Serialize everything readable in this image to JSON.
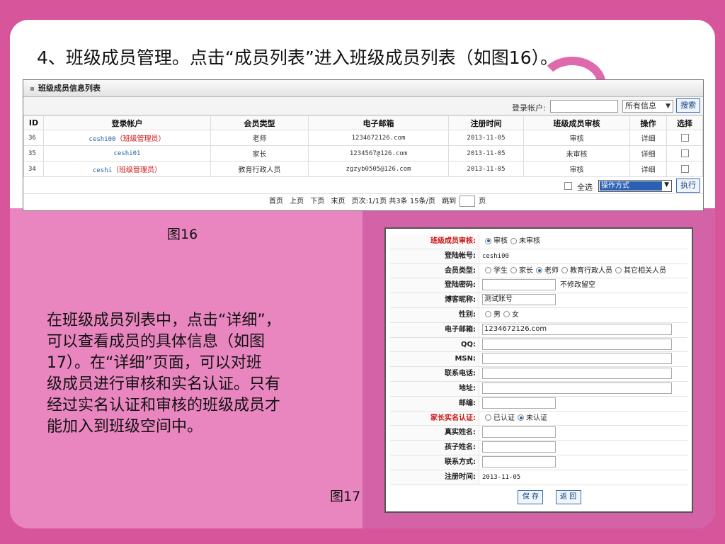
{
  "slide": {
    "heading": "4、班级成员管理。点击“成员列表”进入班级成员列表（如图16）。",
    "caption16": "图16",
    "caption17": "图17",
    "body_lines": [
      "在班级成员列表中，点击“详细”，",
      "可以查看成员的具体信息（如图",
      "17）。在“详细”页面，可以对班",
      "级成员进行审核和实名认证。只有",
      "经过实名认证和审核的班级成员才",
      "能加入到班级空间中。"
    ],
    "colors": {
      "pink_light": "#e986c0",
      "pink_dark": "#d462a6",
      "accent_red": "#d01010",
      "link_blue": "#1f5fa8"
    }
  },
  "fig16": {
    "title": "班级成员信息列表",
    "search": {
      "label": "登录帐户:",
      "value": "",
      "scope": "所有信息",
      "button": "搜索"
    },
    "columns": [
      "ID",
      "登录帐户",
      "会员类型",
      "电子邮箱",
      "注册时间",
      "班级成员审核",
      "操作",
      "选择"
    ],
    "rows": [
      {
        "id": "36",
        "account": "ceshi00",
        "role_tag": "（班级管理员）",
        "type": "老师",
        "email": "1234672126.com",
        "date": "2013-11-05",
        "status": "审核",
        "status_red": false,
        "action": "详细"
      },
      {
        "id": "35",
        "account": "ceshi01",
        "role_tag": "",
        "type": "家长",
        "email": "1234567@126.com",
        "date": "2013-11-05",
        "status": "未审核",
        "status_red": true,
        "action": "详细"
      },
      {
        "id": "34",
        "account": "ceshi",
        "role_tag": "（班级管理员）",
        "type": "教育行政人员",
        "email": "zgzyb0505@126.com",
        "date": "2013-11-05",
        "status": "审核",
        "status_red": false,
        "action": "详细"
      }
    ],
    "select_all": "全选",
    "operation": "操作方式",
    "execute": "执行",
    "pager": {
      "first": "首页",
      "prev": "上页",
      "next": "下页",
      "last": "末页",
      "info": "页次:1/1页 共3条 15条/页",
      "goto": "跳到",
      "page_unit": "页"
    }
  },
  "fig17": {
    "fields": [
      {
        "label": "班级成员审核:",
        "red": true,
        "kind": "radio",
        "options": [
          "审核",
          "未审核"
        ],
        "selected": 0
      },
      {
        "label": "登陆帐号:",
        "kind": "text",
        "value": "ceshi00"
      },
      {
        "label": "会员类型:",
        "kind": "radio",
        "options": [
          "学生",
          "家长",
          "老师",
          "教育行政人员",
          "其它相关人员"
        ],
        "selected": 2
      },
      {
        "label": "登陆密码:",
        "kind": "input",
        "value": "",
        "note": "不修改留空",
        "w": 104
      },
      {
        "label": "博客昵称:",
        "kind": "input",
        "value": "测试账号",
        "w": 104
      },
      {
        "label": "性别:",
        "kind": "radio",
        "options": [
          "男",
          "女"
        ],
        "selected": -1
      },
      {
        "label": "电子邮箱:",
        "kind": "input",
        "value": "1234672126.com",
        "w": 268
      },
      {
        "label": "QQ:",
        "kind": "input",
        "value": "",
        "w": 268
      },
      {
        "label": "MSN:",
        "kind": "input",
        "value": "",
        "w": 268
      },
      {
        "label": "联系电话:",
        "kind": "input",
        "value": "",
        "w": 268
      },
      {
        "label": "地址:",
        "kind": "input",
        "value": "",
        "w": 268
      },
      {
        "label": "邮编:",
        "kind": "input",
        "value": "",
        "w": 104
      },
      {
        "label": "家长实名认证:",
        "red": true,
        "kind": "radio",
        "options": [
          "已认证",
          "未认证"
        ],
        "selected": 1
      },
      {
        "label": "真实姓名:",
        "kind": "input",
        "value": "",
        "w": 104
      },
      {
        "label": "孩子姓名:",
        "kind": "input",
        "value": "",
        "w": 104
      },
      {
        "label": "联系方式:",
        "kind": "input",
        "value": "",
        "w": 104
      },
      {
        "label": "注册时间:",
        "kind": "text",
        "value": "2013-11-05"
      }
    ],
    "save": "保 存",
    "back": "返 回"
  }
}
